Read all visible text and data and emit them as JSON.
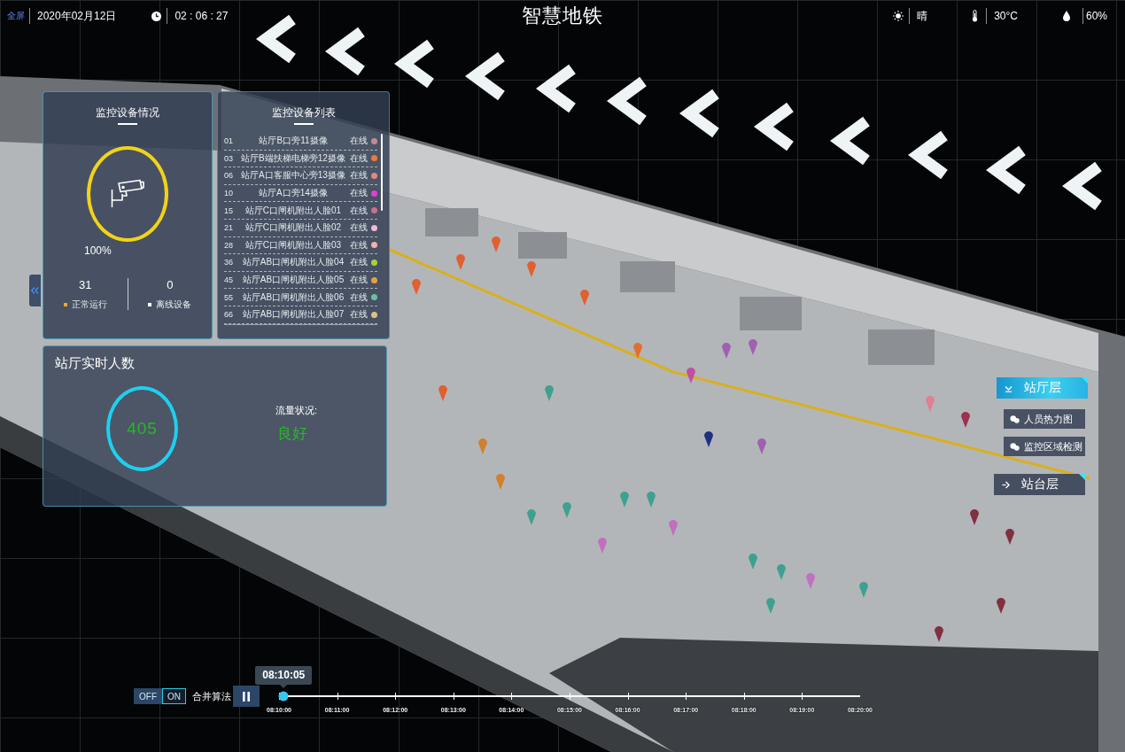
{
  "header": {
    "fullscreen_label": "全屏",
    "date": "2020年02月12日",
    "time": "02 : 06 : 27",
    "title": "智慧地铁",
    "weather": "晴",
    "temperature": "30°C",
    "humidity": "60%"
  },
  "device_status": {
    "title": "监控设备情况",
    "rate": "100%",
    "online_count": "31",
    "offline_count": "0",
    "legend": [
      {
        "label": "正常运行",
        "color": "#f5a623"
      },
      {
        "label": "离线设备",
        "color": "#ffffff"
      }
    ]
  },
  "device_list": {
    "title": "监控设备列表",
    "rows": [
      {
        "id": "01",
        "name": "站厅B口旁11摄像",
        "status": "在线",
        "color": "#c48a94"
      },
      {
        "id": "03",
        "name": "站厅B端扶梯电梯旁12摄像",
        "status": "在线",
        "color": "#f07838"
      },
      {
        "id": "06",
        "name": "站厅A口客服中心旁13摄像",
        "status": "在线",
        "color": "#e08888"
      },
      {
        "id": "10",
        "name": "站厅A口旁14摄像",
        "status": "在线",
        "color": "#e040d0"
      },
      {
        "id": "15",
        "name": "站厅C口闸机附出人脸01",
        "status": "在线",
        "color": "#c8708c"
      },
      {
        "id": "21",
        "name": "站厅C口闸机附出人脸02",
        "status": "在线",
        "color": "#f4b8d8"
      },
      {
        "id": "28",
        "name": "站厅C口闸机附出人脸03",
        "status": "在线",
        "color": "#f0b0b0"
      },
      {
        "id": "36",
        "name": "站厅AB口闸机附出人脸04",
        "status": "在线",
        "color": "#a8d040"
      },
      {
        "id": "45",
        "name": "站厅AB口闸机附出人脸05",
        "status": "在线",
        "color": "#e8a040"
      },
      {
        "id": "55",
        "name": "站厅AB口闸机附出人脸06",
        "status": "在线",
        "color": "#68c0a0"
      },
      {
        "id": "66",
        "name": "站厅AB口闸机附出人脸07",
        "status": "在线",
        "color": "#e0c088"
      }
    ]
  },
  "passenger_count": {
    "title": "站厅实时人数",
    "count": "405",
    "flow_label": "流量状况:",
    "flow_status": "良好"
  },
  "layers": [
    {
      "label": "站厅层",
      "selected": true,
      "expanded": true,
      "children": [
        {
          "label": "人员热力图",
          "selected": false
        },
        {
          "label": "监控区域检测",
          "selected": false
        }
      ]
    },
    {
      "label": "站台层",
      "selected": false,
      "expanded": false
    }
  ],
  "timeline": {
    "merge_toggle": [
      {
        "label": "OFF",
        "selected": false
      },
      {
        "label": "ON",
        "selected": true
      }
    ],
    "merge_label": "合并算法",
    "playing": true,
    "current_time": "08:10:05",
    "level": 0.008,
    "tick_labels": [
      "08:10:00",
      "08:11:00",
      "08:12:00",
      "08:13:00",
      "08:14:00",
      "08:15:00",
      "08:16:00",
      "08:17:00",
      "08:18:00",
      "08:19:00",
      "08:20:00"
    ]
  }
}
